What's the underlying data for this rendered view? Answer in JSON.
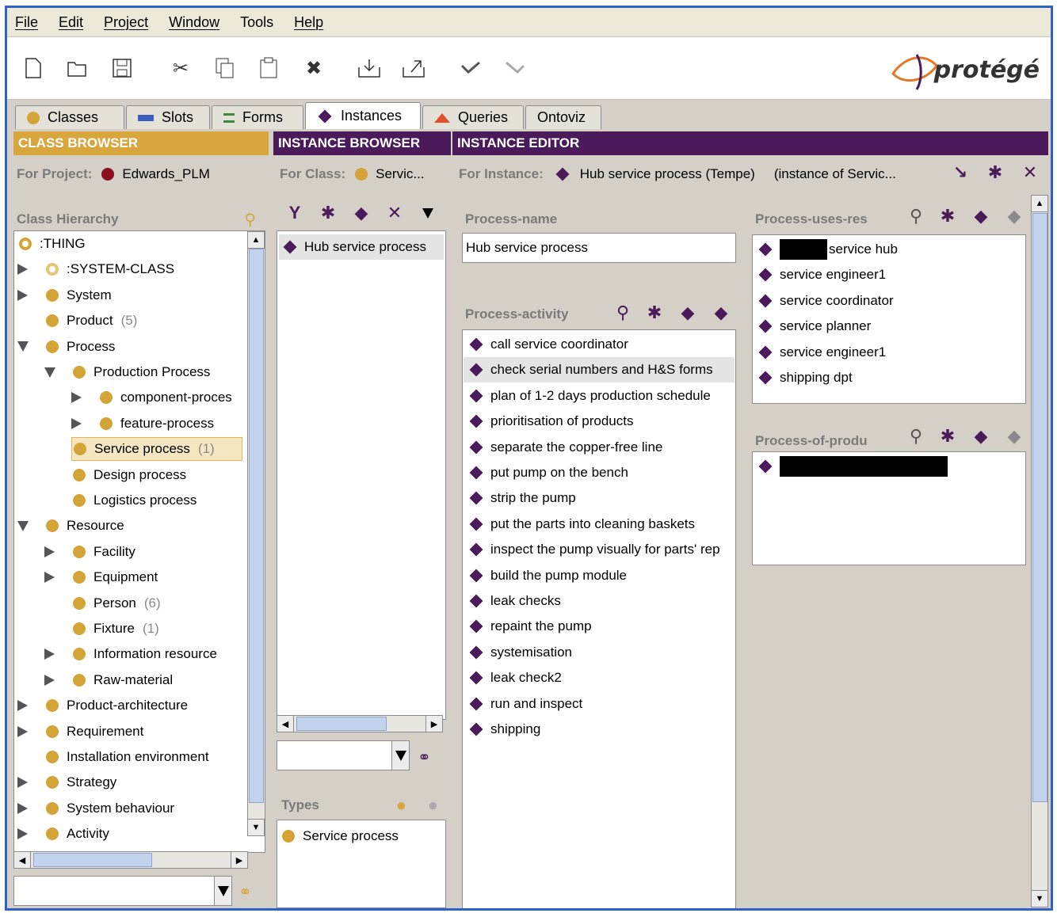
{
  "menu": [
    "File",
    "Edit",
    "Project",
    "Window",
    "Tools",
    "Help"
  ],
  "logo": {
    "text": "protégé"
  },
  "tabs": [
    {
      "label": "Classes",
      "icon": "class-icon"
    },
    {
      "label": "Slots",
      "icon": "slot-icon"
    },
    {
      "label": "Forms",
      "icon": "form-icon"
    },
    {
      "label": "Instances",
      "icon": "instance-icon"
    },
    {
      "label": "Queries",
      "icon": "query-icon"
    },
    {
      "label": "Ontoviz",
      "icon": ""
    }
  ],
  "active_tab": "Instances",
  "class_browser": {
    "title": "CLASS BROWSER",
    "for_project_label": "For Project:",
    "project": "Edwards_PLM",
    "hierarchy_label": "Class Hierarchy",
    "tree": [
      {
        "label": ":THING",
        "indent": 0,
        "expander": "none",
        "count": "",
        "icon": "hollow"
      },
      {
        "label": ":SYSTEM-CLASS",
        "indent": 1,
        "expander": "collapsed",
        "count": "",
        "icon": "hollow-gray"
      },
      {
        "label": "System",
        "indent": 1,
        "expander": "collapsed",
        "count": "",
        "icon": "dot"
      },
      {
        "label": "Product",
        "indent": 1,
        "expander": "none",
        "count": "(5)",
        "icon": "dot"
      },
      {
        "label": "Process",
        "indent": 1,
        "expander": "expanded",
        "count": "",
        "icon": "dot"
      },
      {
        "label": "Production Process",
        "indent": 2,
        "expander": "expanded",
        "count": "",
        "icon": "dot"
      },
      {
        "label": "component-proces",
        "indent": 3,
        "expander": "collapsed",
        "count": "",
        "icon": "dot"
      },
      {
        "label": "feature-process",
        "indent": 3,
        "expander": "collapsed",
        "count": "",
        "icon": "dot"
      },
      {
        "label": "Service process",
        "indent": 2,
        "expander": "none",
        "count": "(1)",
        "icon": "dot",
        "selected": true
      },
      {
        "label": "Design process",
        "indent": 2,
        "expander": "none",
        "count": "",
        "icon": "dot"
      },
      {
        "label": "Logistics process",
        "indent": 2,
        "expander": "none",
        "count": "",
        "icon": "dot"
      },
      {
        "label": "Resource",
        "indent": 1,
        "expander": "expanded",
        "count": "",
        "icon": "dot"
      },
      {
        "label": "Facility",
        "indent": 2,
        "expander": "collapsed",
        "count": "",
        "icon": "dot"
      },
      {
        "label": "Equipment",
        "indent": 2,
        "expander": "collapsed",
        "count": "",
        "icon": "dot"
      },
      {
        "label": "Person",
        "indent": 2,
        "expander": "none",
        "count": "(6)",
        "icon": "dot"
      },
      {
        "label": "Fixture",
        "indent": 2,
        "expander": "none",
        "count": "(1)",
        "icon": "dot"
      },
      {
        "label": "Information resource",
        "indent": 2,
        "expander": "collapsed",
        "count": "",
        "icon": "dot"
      },
      {
        "label": "Raw-material",
        "indent": 2,
        "expander": "collapsed",
        "count": "",
        "icon": "dot"
      },
      {
        "label": "Product-architecture",
        "indent": 1,
        "expander": "collapsed",
        "count": "",
        "icon": "dot"
      },
      {
        "label": "Requirement",
        "indent": 1,
        "expander": "collapsed",
        "count": "",
        "icon": "dot"
      },
      {
        "label": "Installation environment",
        "indent": 1,
        "expander": "none",
        "count": "",
        "icon": "dot"
      },
      {
        "label": "Strategy",
        "indent": 1,
        "expander": "collapsed",
        "count": "",
        "icon": "dot"
      },
      {
        "label": "System behaviour",
        "indent": 1,
        "expander": "collapsed",
        "count": "",
        "icon": "dot"
      },
      {
        "label": "Activity",
        "indent": 1,
        "expander": "collapsed",
        "count": "",
        "icon": "dot"
      }
    ]
  },
  "instance_browser": {
    "title": "INSTANCE BROWSER",
    "for_class_label": "For Class:",
    "class": "Servic...",
    "instances": [
      "Hub service process"
    ],
    "types_label": "Types",
    "types": [
      "Service process"
    ]
  },
  "instance_editor": {
    "title": "INSTANCE EDITOR",
    "for_instance_label": "For Instance:",
    "instance": "Hub service process (Tempe)",
    "instance_of": "(instance of Servic...",
    "process_name_label": "Process-name",
    "process_name_value": "Hub service process",
    "process_activity_label": "Process-activity",
    "activities": [
      "call service coordinator",
      "check serial numbers and H&S forms",
      "plan of 1-2 days production schedule",
      "prioritisation of products",
      "separate the copper-free line",
      "put pump on the bench",
      "strip the pump",
      "put the parts into cleaning baskets",
      "inspect the pump visually for parts' rep",
      "build the pump module",
      "leak checks",
      "repaint the pump",
      "systemisation",
      "leak check2",
      "run and inspect",
      "shipping"
    ],
    "uses_res_label": "Process-uses-res",
    "uses_res": [
      {
        "text": "service hub",
        "redacted_prefix": true
      },
      {
        "text": "service engineer1"
      },
      {
        "text": "service coordinator"
      },
      {
        "text": "service planner"
      },
      {
        "text": "service engineer1"
      },
      {
        "text": "shipping dpt"
      }
    ],
    "of_product_label": "Process-of-produ",
    "of_product": [
      {
        "text": "",
        "redacted": true
      }
    ]
  },
  "colors": {
    "class_header": "#d9a53d",
    "instance_header": "#4a1a5a",
    "window_border": "#2f62c9"
  }
}
